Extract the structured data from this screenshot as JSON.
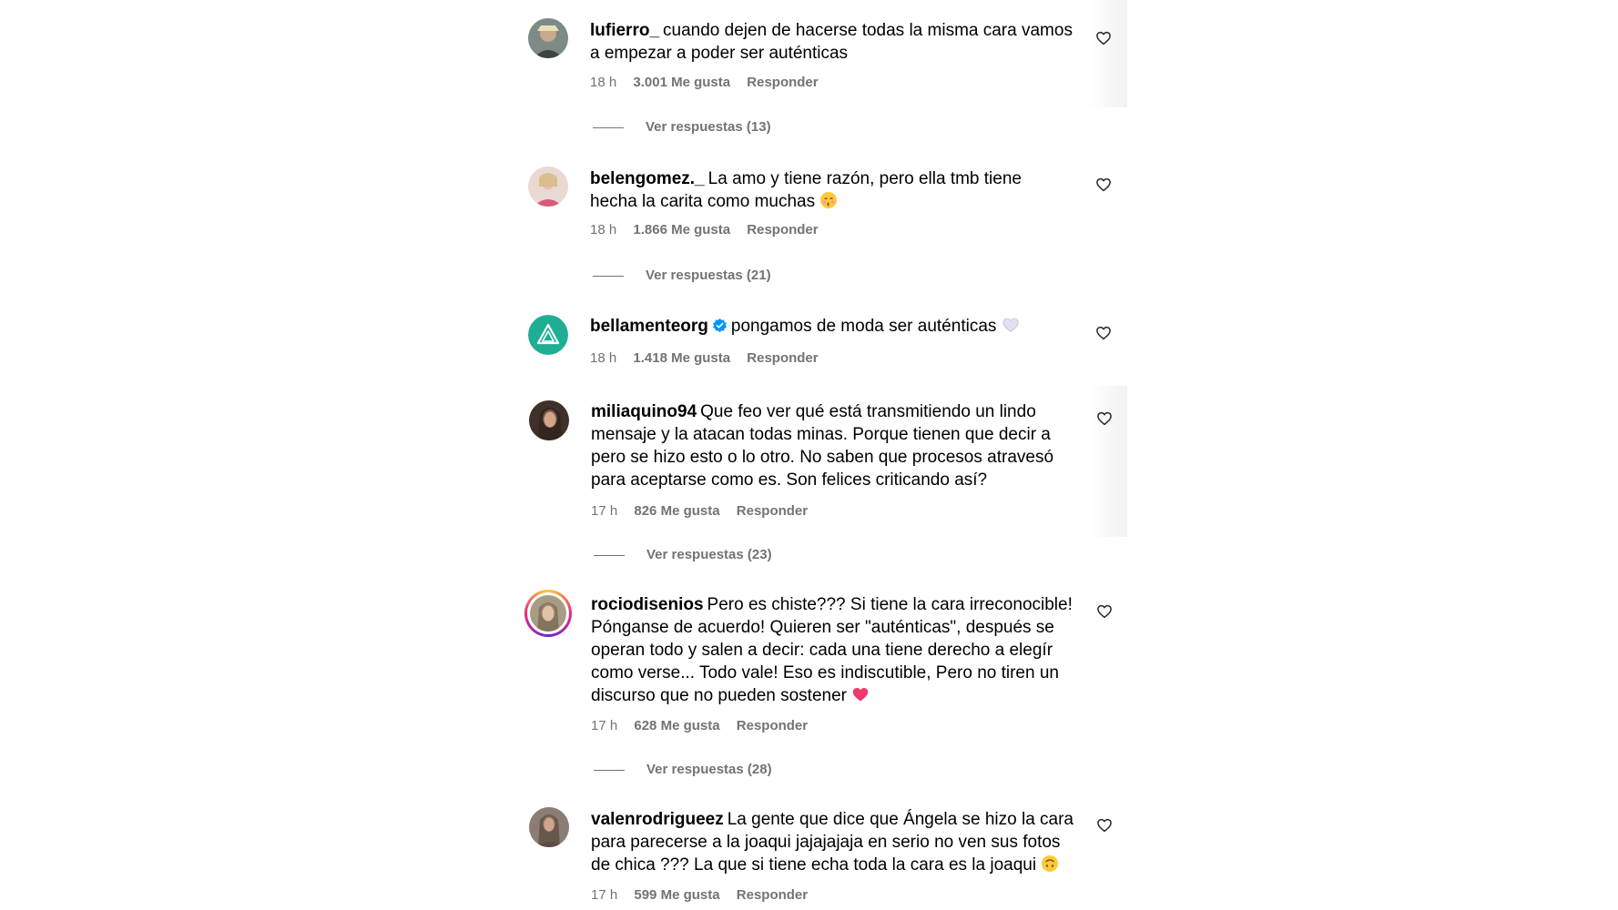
{
  "comments": [
    {
      "username": "lufierro_",
      "text": "cuando dejen de hacerse todas la misma cara vamos a empezar a poder ser auténticas",
      "time": "18 h",
      "likes": "3.001 Me gusta",
      "reply": "Responder",
      "replies": "Ver respuestas (13)"
    },
    {
      "username": "belengomez._",
      "text": "La amo y tiene razón, pero ella tmb tiene hecha la carita como muchas",
      "emoji": "😚",
      "time": "18 h",
      "likes": "1.866 Me gusta",
      "reply": "Responder",
      "replies": "Ver respuestas (21)"
    },
    {
      "username": "bellamenteorg",
      "verified": true,
      "text": "pongamos de moda ser auténticas",
      "emoji": "🤍",
      "time": "18 h",
      "likes": "1.418 Me gusta",
      "reply": "Responder"
    },
    {
      "username": "miliaquino94",
      "text": "Que feo ver qué está transmitiendo un lindo mensaje y la atacan todas minas. Porque tienen que decir a pero se hizo esto o lo otro. No saben que procesos atravesó para aceptarse como es. Son felices criticando así?",
      "time": "17 h",
      "likes": "826 Me gusta",
      "reply": "Responder",
      "replies": "Ver respuestas (23)"
    },
    {
      "username": "rociodisenios",
      "text": "Pero es chiste??? Si tiene la cara irreconocible! Pónganse de acuerdo! Quieren ser \"auténticas\", después se operan todo y salen a decir: cada una tiene derecho a elegír como verse... Todo vale! Eso es indiscutible, Pero no tiren un discurso que no pueden sostener",
      "emoji": "❤️",
      "time": "17 h",
      "likes": "628 Me gusta",
      "reply": "Responder",
      "replies": "Ver respuestas (28)"
    },
    {
      "username": "valenrodrigueez",
      "text": "La gente que dice que Ángela se hizo la cara para parecerse a la joaqui jajajajaja en serio no ven sus fotos de chica ??? La que si tiene echa toda la cara es la joaqui",
      "emoji": "🙃",
      "time": "17 h",
      "likes": "599 Me gusta",
      "reply": "Responder"
    }
  ],
  "colors": {
    "text": "#000000",
    "secondary": "#737373",
    "verified": "#0095f6",
    "like_heart_emoji": "#f0386b",
    "avatar_teal": "#1fae94"
  },
  "icons": {
    "like": "heart-outline-icon",
    "verified": "verified-badge-icon"
  }
}
